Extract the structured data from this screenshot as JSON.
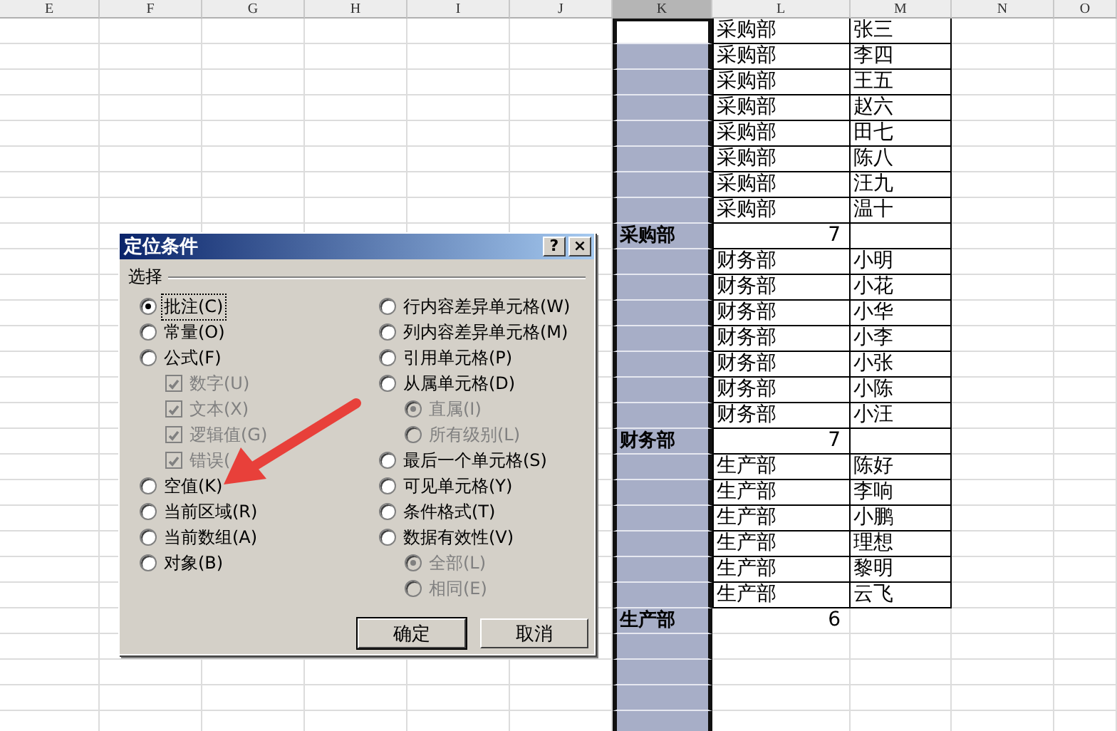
{
  "sheet": {
    "columns": [
      {
        "label": "E",
        "selected": false
      },
      {
        "label": "F",
        "selected": false
      },
      {
        "label": "G",
        "selected": false
      },
      {
        "label": "H",
        "selected": false
      },
      {
        "label": "I",
        "selected": false
      },
      {
        "label": "J",
        "selected": false
      },
      {
        "label": "K",
        "selected": true
      },
      {
        "label": "L",
        "selected": false
      },
      {
        "label": "M",
        "selected": false
      },
      {
        "label": "N",
        "selected": false
      },
      {
        "label": "O",
        "selected": false
      }
    ],
    "rows": [
      {
        "kind": "data",
        "active": true,
        "bordered": true,
        "k": "",
        "l": "采购部",
        "m": "张三"
      },
      {
        "kind": "data",
        "active": false,
        "bordered": true,
        "k": "",
        "l": "采购部",
        "m": "李四"
      },
      {
        "kind": "data",
        "active": false,
        "bordered": true,
        "k": "",
        "l": "采购部",
        "m": "王五"
      },
      {
        "kind": "data",
        "active": false,
        "bordered": true,
        "k": "",
        "l": "采购部",
        "m": "赵六"
      },
      {
        "kind": "data",
        "active": false,
        "bordered": true,
        "k": "",
        "l": "采购部",
        "m": "田七"
      },
      {
        "kind": "data",
        "active": false,
        "bordered": true,
        "k": "",
        "l": "采购部",
        "m": "陈八"
      },
      {
        "kind": "data",
        "active": false,
        "bordered": true,
        "k": "",
        "l": "采购部",
        "m": "汪九"
      },
      {
        "kind": "data",
        "active": false,
        "bordered": true,
        "k": "",
        "l": "采购部",
        "m": "温十"
      },
      {
        "kind": "total",
        "active": false,
        "bordered": true,
        "k": "采购部",
        "l": "7",
        "m": ""
      },
      {
        "kind": "data",
        "active": false,
        "bordered": true,
        "k": "",
        "l": "财务部",
        "m": "小明"
      },
      {
        "kind": "data",
        "active": false,
        "bordered": true,
        "k": "",
        "l": "财务部",
        "m": "小花"
      },
      {
        "kind": "data",
        "active": false,
        "bordered": true,
        "k": "",
        "l": "财务部",
        "m": "小华"
      },
      {
        "kind": "data",
        "active": false,
        "bordered": true,
        "k": "",
        "l": "财务部",
        "m": "小李"
      },
      {
        "kind": "data",
        "active": false,
        "bordered": true,
        "k": "",
        "l": "财务部",
        "m": "小张"
      },
      {
        "kind": "data",
        "active": false,
        "bordered": true,
        "k": "",
        "l": "财务部",
        "m": "小陈"
      },
      {
        "kind": "data",
        "active": false,
        "bordered": true,
        "k": "",
        "l": "财务部",
        "m": "小汪"
      },
      {
        "kind": "total",
        "active": false,
        "bordered": true,
        "k": "财务部",
        "l": "7",
        "m": ""
      },
      {
        "kind": "data",
        "active": false,
        "bordered": true,
        "k": "",
        "l": "生产部",
        "m": "陈好"
      },
      {
        "kind": "data",
        "active": false,
        "bordered": true,
        "k": "",
        "l": "生产部",
        "m": "李响"
      },
      {
        "kind": "data",
        "active": false,
        "bordered": true,
        "k": "",
        "l": "生产部",
        "m": "小鹏"
      },
      {
        "kind": "data",
        "active": false,
        "bordered": true,
        "k": "",
        "l": "生产部",
        "m": "理想"
      },
      {
        "kind": "data",
        "active": false,
        "bordered": true,
        "k": "",
        "l": "生产部",
        "m": "黎明"
      },
      {
        "kind": "data",
        "active": false,
        "bordered": true,
        "k": "",
        "l": "生产部",
        "m": "云飞"
      },
      {
        "kind": "total",
        "active": false,
        "bordered": false,
        "k": "生产部",
        "l": "6",
        "m": ""
      }
    ]
  },
  "dialog": {
    "title": "定位条件",
    "title_buttons": [
      "?",
      "×"
    ],
    "group_label": "选择",
    "left_options": [
      {
        "kind": "radio",
        "label": "批注(C)",
        "selected": true,
        "disabled": false,
        "focused": true
      },
      {
        "kind": "radio",
        "label": "常量(O)",
        "selected": false,
        "disabled": false,
        "focused": false
      },
      {
        "kind": "radio",
        "label": "公式(F)",
        "selected": false,
        "disabled": false,
        "focused": false,
        "children": [
          {
            "kind": "checkbox",
            "label": "数字(U)",
            "checked": true,
            "disabled": true
          },
          {
            "kind": "checkbox",
            "label": "文本(X)",
            "checked": true,
            "disabled": true
          },
          {
            "kind": "checkbox",
            "label": "逻辑值(G)",
            "checked": true,
            "disabled": true
          },
          {
            "kind": "checkbox",
            "label": "错误(",
            "checked": true,
            "disabled": true
          }
        ]
      },
      {
        "kind": "radio",
        "label": "空值(K)",
        "selected": false,
        "disabled": false,
        "focused": false
      },
      {
        "kind": "radio",
        "label": "当前区域(R)",
        "selected": false,
        "disabled": false,
        "focused": false
      },
      {
        "kind": "radio",
        "label": "当前数组(A)",
        "selected": false,
        "disabled": false,
        "focused": false
      },
      {
        "kind": "radio",
        "label": "对象(B)",
        "selected": false,
        "disabled": false,
        "focused": false
      }
    ],
    "right_options": [
      {
        "kind": "radio",
        "label": "行内容差异单元格(W)",
        "selected": false,
        "disabled": false,
        "focused": false
      },
      {
        "kind": "radio",
        "label": "列内容差异单元格(M)",
        "selected": false,
        "disabled": false,
        "focused": false
      },
      {
        "kind": "radio",
        "label": "引用单元格(P)",
        "selected": false,
        "disabled": false,
        "focused": false
      },
      {
        "kind": "radio",
        "label": "从属单元格(D)",
        "selected": false,
        "disabled": false,
        "focused": false,
        "children": [
          {
            "kind": "radio",
            "label": "直属(I)",
            "selected": true,
            "disabled": true,
            "focused": false
          },
          {
            "kind": "radio",
            "label": "所有级别(L)",
            "selected": false,
            "disabled": true,
            "focused": false
          }
        ]
      },
      {
        "kind": "radio",
        "label": "最后一个单元格(S)",
        "selected": false,
        "disabled": false,
        "focused": false
      },
      {
        "kind": "radio",
        "label": "可见单元格(Y)",
        "selected": false,
        "disabled": false,
        "focused": false
      },
      {
        "kind": "radio",
        "label": "条件格式(T)",
        "selected": false,
        "disabled": false,
        "focused": false
      },
      {
        "kind": "radio",
        "label": "数据有效性(V)",
        "selected": false,
        "disabled": false,
        "focused": false,
        "children": [
          {
            "kind": "radio",
            "label": "全部(L)",
            "selected": true,
            "disabled": true,
            "focused": false
          },
          {
            "kind": "radio",
            "label": "相同(E)",
            "selected": false,
            "disabled": true,
            "focused": false
          }
        ]
      }
    ],
    "buttons": [
      {
        "label": "确定",
        "default": true
      },
      {
        "label": "取消",
        "default": false
      }
    ]
  }
}
